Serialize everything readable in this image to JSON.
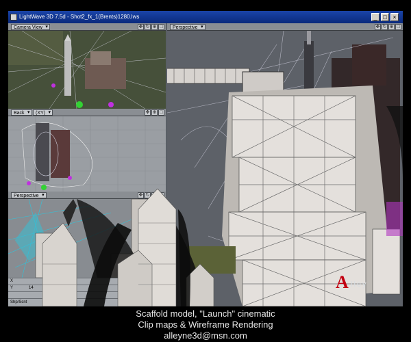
{
  "app": {
    "title": "LightWave 3D 7.5d - Shot2_fx_1(Brents)1280.lws",
    "window_buttons": [
      "_",
      "□",
      "×"
    ]
  },
  "viewports": {
    "camera_view": {
      "label": "Camera View"
    },
    "back": {
      "label": "Back",
      "zoom": "(XY)"
    },
    "perspective_small": {
      "label": "Perspective"
    },
    "perspective_large": {
      "label": "Perspective"
    }
  },
  "toolbar_icons": [
    "move-view-icon",
    "rotate-view-icon",
    "zoom-view-icon",
    "maximize-view-icon"
  ],
  "status": {
    "x_label": "X",
    "y_label": "Y",
    "x_value": "",
    "y_value": "14",
    "z_value": "",
    "bar_text": "Shp/Scnt"
  },
  "caption": {
    "line1": "Scaffold model, \"Launch\" cinematic",
    "line2": "Clip maps & Wireframe Rendering",
    "line3": "alleyne3d@msn.com"
  },
  "watermark": {
    "letter": "A",
    "rest": "lley"
  },
  "colors": {
    "titlebar": "#0a2a7c",
    "viewport_bg": "#5a5f66",
    "camera_grass": "#3d4630",
    "wireframe": "#d8d8e6",
    "selection_purple": "#c030e0",
    "cyan_wire": "#27c9e2",
    "green_handle": "#33d233",
    "accent_red": "#c20010"
  }
}
